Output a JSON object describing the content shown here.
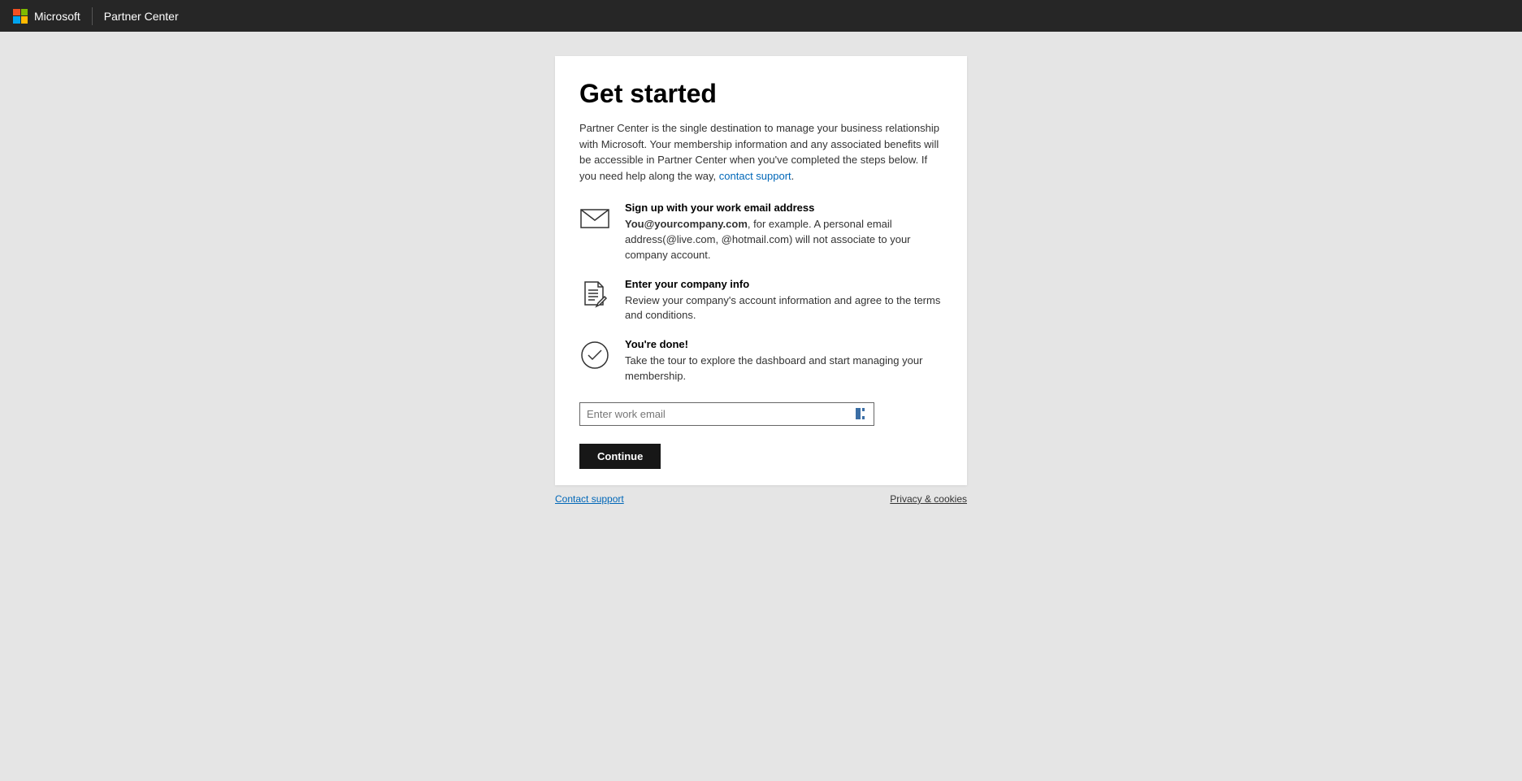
{
  "header": {
    "brand": "Microsoft",
    "title": "Partner Center"
  },
  "page": {
    "title": "Get started",
    "intro_prefix": "Partner Center is the single destination to manage your business relationship with Microsoft. Your membership information and any associated benefits will be accessible in Partner Center when you've completed the steps below. If you need help along the way, ",
    "intro_link": "contact support",
    "intro_suffix": "."
  },
  "steps": [
    {
      "title": "Sign up with your work email address",
      "desc_strong": "You@yourcompany.com",
      "desc_rest": ", for example. A personal email address(@live.com, @hotmail.com) will not associate to your company account."
    },
    {
      "title": "Enter your company info",
      "desc": "Review your company's account information and agree to the terms and conditions."
    },
    {
      "title": "You're done!",
      "desc": "Take the tour to explore the dashboard and start managing your membership."
    }
  ],
  "form": {
    "email_placeholder": "Enter work email",
    "continue_label": "Continue"
  },
  "footer": {
    "contact_support": "Contact support",
    "privacy": "Privacy & cookies"
  }
}
